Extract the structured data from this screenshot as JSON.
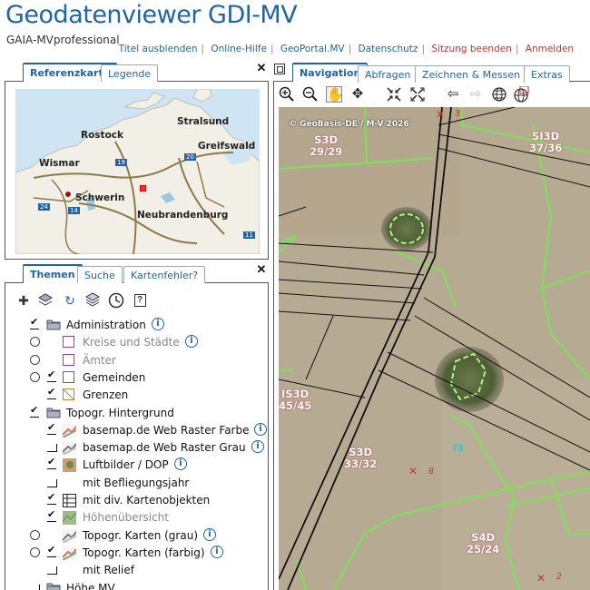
{
  "header": {
    "title": "Geodatenviewer GDI-MV",
    "subtitle": "GAIA-MVprofessional",
    "links": [
      {
        "label": "Titel ausblenden",
        "color": "#1f64a8"
      },
      {
        "label": "Online-Hilfe",
        "color": "#1f64a8"
      },
      {
        "label": "GeoPortal.MV",
        "color": "#1f64a8"
      },
      {
        "label": "Datenschutz",
        "color": "#1f64a8"
      },
      {
        "label": "Sitzung beenden",
        "color": "#c8322d"
      },
      {
        "label": "Anmelden",
        "color": "#c8322d"
      }
    ]
  },
  "top_panel": {
    "tabs": [
      {
        "label": "Referenzkarte",
        "active": true
      },
      {
        "label": "Legende",
        "active": false
      }
    ],
    "close_glyph": "✕"
  },
  "refmap": {
    "cities": [
      "Rostock",
      "Stralsund",
      "Greifswald",
      "Wismar",
      "Schwerin",
      "Neubrandenburg"
    ],
    "road_numbers": [
      "19",
      "20",
      "24",
      "14",
      "11"
    ]
  },
  "themes_panel": {
    "tabs": [
      {
        "label": "Themen",
        "active": true
      },
      {
        "label": "Suche",
        "active": false
      },
      {
        "label": "Kartenfehler?",
        "active": false
      }
    ],
    "close_glyph": "✕",
    "toolbar_icons": [
      "add-layer-icon",
      "layers-icon",
      "refresh-icon",
      "layers-stack-icon",
      "clock-icon",
      "help-icon"
    ]
  },
  "tree": [
    {
      "label": "Administration",
      "ctrl": "check",
      "symbol": "folder",
      "info": true,
      "gray": false,
      "indent": 0
    },
    {
      "label": "Kreise und Städte",
      "ctrl": "radio",
      "symbol": "box-purple",
      "info": true,
      "gray": true,
      "indent": 1
    },
    {
      "label": "Ämter",
      "ctrl": "radio",
      "symbol": "box-purple",
      "info": false,
      "gray": true,
      "indent": 1
    },
    {
      "label": "Gemeinden",
      "ctrl": "radio-check",
      "symbol": "box-purple",
      "info": false,
      "gray": false,
      "indent": 1
    },
    {
      "label": "Grenzen",
      "ctrl": "check",
      "symbol": "box-orange",
      "info": false,
      "gray": false,
      "indent": 1
    },
    {
      "label": "Topogr. Hintergrund",
      "ctrl": "check",
      "symbol": "folder",
      "info": false,
      "gray": false,
      "indent": 0
    },
    {
      "label": "basemap.de Web Raster Farbe",
      "ctrl": "check",
      "symbol": "map-color",
      "info": true,
      "gray": false,
      "indent": 1
    },
    {
      "label": "basemap.de Web Raster Grau",
      "ctrl": "empty",
      "symbol": "map-gray",
      "info": true,
      "gray": false,
      "indent": 1
    },
    {
      "label": "Luftbilder / DOP",
      "ctrl": "check",
      "symbol": "photo",
      "info": true,
      "gray": false,
      "indent": 1
    },
    {
      "label": "mit Befliegungsjahr",
      "ctrl": "empty",
      "symbol": "none",
      "info": false,
      "gray": false,
      "indent": 1
    },
    {
      "label": "mit div. Kartenobjekten",
      "ctrl": "check",
      "symbol": "grid",
      "info": false,
      "gray": false,
      "indent": 1
    },
    {
      "label": "Höhenübersicht",
      "ctrl": "check",
      "symbol": "relief",
      "info": false,
      "gray": true,
      "indent": 1
    },
    {
      "label": "Topogr. Karten (grau)",
      "ctrl": "radio",
      "symbol": "map-gray",
      "info": true,
      "gray": false,
      "indent": 1
    },
    {
      "label": "Topogr. Karten (farbig)",
      "ctrl": "radio-check",
      "symbol": "map-color",
      "info": true,
      "gray": false,
      "indent": 1
    },
    {
      "label": "mit Relief",
      "ctrl": "empty",
      "symbol": "none",
      "info": false,
      "gray": false,
      "indent": 1
    },
    {
      "label": "Höhe MV",
      "ctrl": "empty",
      "symbol": "folder",
      "info": false,
      "gray": false,
      "indent": 0
    }
  ],
  "right_panel": {
    "tabs": [
      {
        "label": "Navigation",
        "active": true
      },
      {
        "label": "Abfragen",
        "active": false
      },
      {
        "label": "Zeichnen & Messen",
        "active": false
      },
      {
        "label": "Extras",
        "active": false
      }
    ],
    "nav_tools": [
      "zoom-in-icon",
      "zoom-out-icon",
      "pan-hand-icon",
      "move-icon",
      "zoom-extent-in-icon",
      "zoom-extent-out-icon",
      "back-arrow-icon",
      "forward-arrow-icon",
      "globe-icon",
      "globe-info-icon"
    ]
  },
  "map": {
    "copyright": "© GeoBasis-DE / M-V 2026",
    "parcel_labels": [
      {
        "line1": "S3D",
        "line2": "29/29"
      },
      {
        "line1": "SI3D",
        "line2": "37/36"
      },
      {
        "line1": "IS3D",
        "line2": "45/45"
      },
      {
        "line1": "S3D",
        "line2": "33/32"
      },
      {
        "line1": "S4D",
        "line2": "25/24"
      }
    ],
    "point_numbers": [
      "3",
      "8",
      "2"
    ],
    "cyan_label": "73",
    "colors": {
      "field": "#b7aa93",
      "parcel_line": "#7ee05a",
      "road": "#111111",
      "label_red": "#c8322d"
    }
  }
}
